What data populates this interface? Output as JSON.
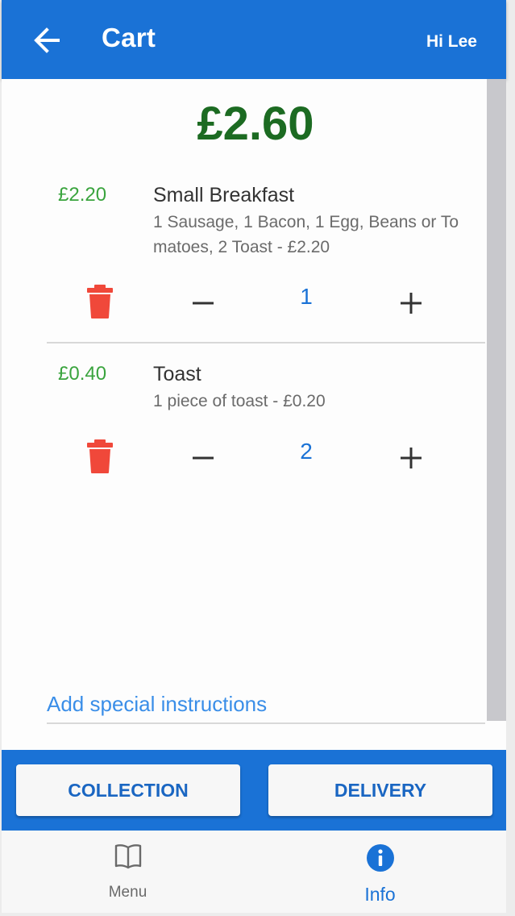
{
  "appbar": {
    "title": "Cart",
    "greeting": "Hi Lee"
  },
  "cart": {
    "total": "£2.60",
    "items": [
      {
        "price": "£2.20",
        "name": "Small Breakfast",
        "description": "1 Sausage, 1 Bacon, 1 Egg, Beans or Tomatoes, 2 Toast - £2.20",
        "quantity": "1"
      },
      {
        "price": "£0.40",
        "name": "Toast",
        "description": "1 piece of toast - £0.20",
        "quantity": "2"
      }
    ],
    "special_instructions_label": "Add special instructions"
  },
  "actions": {
    "collection_label": "COLLECTION",
    "delivery_label": "DELIVERY"
  },
  "bottom_nav": {
    "items": [
      {
        "label": "Menu",
        "icon": "book-icon",
        "active": false
      },
      {
        "label": "Info",
        "icon": "info-icon",
        "active": true
      }
    ]
  },
  "colors": {
    "primary": "#1a72d6",
    "total_green": "#1c6b22",
    "price_green": "#3aa43e",
    "delete_red": "#f0483a",
    "link_blue": "#3a8ee8"
  }
}
